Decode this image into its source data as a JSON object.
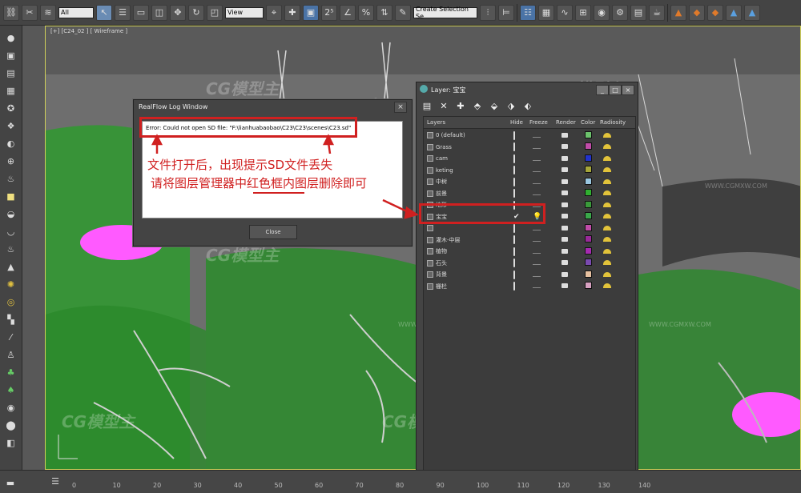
{
  "toolbar": {
    "selection_filter": "All",
    "reference_coord": "View",
    "named_selection": "Create Selection Se"
  },
  "viewport": {
    "label": "[+] [C24_02 ] [ Wireframe ]"
  },
  "realflow": {
    "title": "RealFlow Log Window",
    "error_text": "Error: Could not open SD file: \"F:\\lianhuabaobao\\C23\\C23\\scenes\\C23.sd\"",
    "close_label": "Close"
  },
  "layer_window": {
    "title": "Layer: 宝宝",
    "headers": {
      "layers": "Layers",
      "hide": "Hide",
      "freeze": "Freeze",
      "render": "Render",
      "color": "Color",
      "radiosity": "Radiosity"
    },
    "rows": [
      {
        "name": "0 (default)",
        "color": "#6cc26c"
      },
      {
        "name": "Grass",
        "color": "#c04ca8"
      },
      {
        "name": "cam",
        "color": "#2233cc"
      },
      {
        "name": "keting",
        "color": "#a6a63a"
      },
      {
        "name": "中树",
        "color": "#9ac7e0"
      },
      {
        "name": "前景",
        "color": "#30b030"
      },
      {
        "name": "地形",
        "color": "#3a9a3a"
      },
      {
        "name": "宝宝",
        "color": "#3aa84a",
        "current": true
      },
      {
        "name": "",
        "color": "#c04ca8"
      },
      {
        "name": "灌木-中层",
        "color": "#9a2a9a"
      },
      {
        "name": "植物",
        "color": "#a62ab0"
      },
      {
        "name": "石头",
        "color": "#7a4ab0"
      },
      {
        "name": "背景",
        "color": "#e6c0a0"
      },
      {
        "name": "栅栏",
        "color": "#d6a0c0"
      }
    ]
  },
  "annotation": {
    "line1": "文件打开后，出现提示SD文件丢失",
    "line2": "请将图层管理器中红色框内图层删除即可"
  },
  "watermark": {
    "brand": "CG模型主",
    "url": "WWW.CGMXW.COM"
  },
  "timeline": {
    "ticks": [
      "0",
      "10",
      "20",
      "30",
      "40",
      "50",
      "60",
      "70",
      "80",
      "90",
      "100",
      "110",
      "120",
      "130",
      "140"
    ]
  },
  "colors": {
    "annotation_red": "#d02020",
    "viewport_border": "#cfcf5a",
    "grass_green": "#2f9a2f",
    "magenta": "#ff5aff"
  }
}
